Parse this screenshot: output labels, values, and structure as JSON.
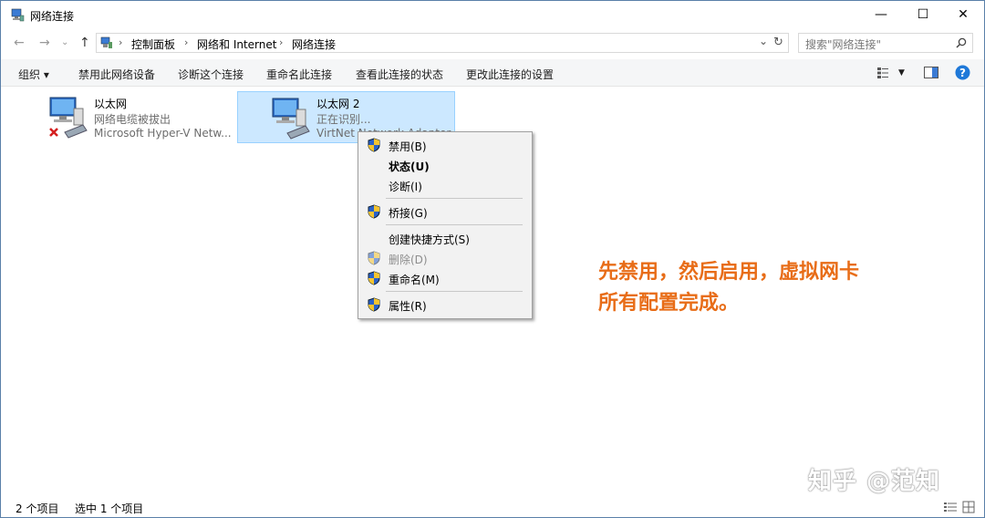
{
  "window": {
    "title": "网络连接",
    "controls": {
      "minimize": "—",
      "maximize": "☐",
      "close": "✕"
    }
  },
  "nav": {
    "back": "←",
    "forward": "→",
    "recent": "⌄",
    "up": "↑"
  },
  "address": {
    "crumbs": [
      "控制面板",
      "网络和 Internet",
      "网络连接"
    ],
    "dropdown": "⌄",
    "refresh": "↻"
  },
  "search": {
    "placeholder": "搜索\"网络连接\""
  },
  "toolbar": {
    "organize": "组织 ▾",
    "disable_device": "禁用此网络设备",
    "diagnose": "诊断这个连接",
    "rename": "重命名此连接",
    "view_status": "查看此连接的状态",
    "change_settings": "更改此连接的设置"
  },
  "items": [
    {
      "name": "以太网",
      "status": "网络电缆被拔出",
      "device": "Microsoft Hyper-V Netw..."
    },
    {
      "name": "以太网 2",
      "status": "正在识别...",
      "device": "VirtNet Network Adapter"
    }
  ],
  "context_menu": {
    "disable": "禁用(B)",
    "status": "状态(U)",
    "diagnose": "诊断(I)",
    "bridge": "桥接(G)",
    "create_shortcut": "创建快捷方式(S)",
    "delete": "删除(D)",
    "rename": "重命名(M)",
    "properties": "属性(R)"
  },
  "annotation": {
    "line1": "先禁用，然后启用，虚拟网卡",
    "line2": "所有配置完成。"
  },
  "statusbar": {
    "count": "2 个项目",
    "selected": "选中 1 个项目"
  },
  "watermark": "知乎 @范知",
  "colors": {
    "annotation": "#e86d18",
    "selection": "#cce8ff",
    "help": "#1e78d8"
  }
}
